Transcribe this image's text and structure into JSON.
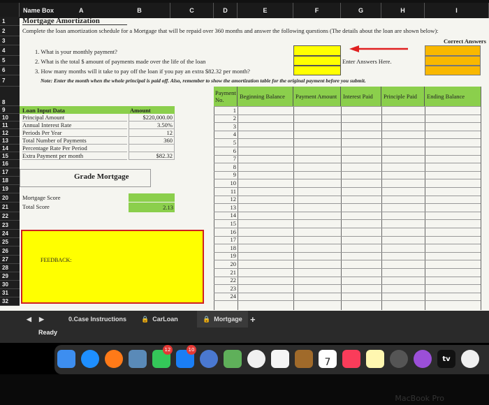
{
  "name_box": {
    "label": "Name Box",
    "current_col": "A"
  },
  "columns": [
    "B",
    "C",
    "D",
    "E",
    "F",
    "G",
    "H",
    "I"
  ],
  "rows": [
    "1",
    "2",
    "3",
    "4",
    "5",
    "6",
    "7",
    "8",
    "9",
    "10",
    "11",
    "12",
    "13",
    "14",
    "15",
    "16",
    "17",
    "18",
    "19",
    "20",
    "21",
    "22",
    "23",
    "24",
    "25",
    "26",
    "27",
    "28",
    "29",
    "30",
    "31",
    "32"
  ],
  "title": "Mortgage Amortization",
  "instructions": "Complete the loan amortization schedule for a Mortgage that will be repaid over 360 months and answer the following questions (The details about the loan are shown below):",
  "correct_answers_label": "Correct Answers",
  "questions": [
    "1. What is your monthly payment?",
    "2. What is the total $ amount of payments made over the life of the loan",
    "3. How many months will it take to pay off the loan if you pay an extra $82.32 per month?"
  ],
  "note": "Note: Enter the month when the whole principal is paid off. Also, remember to show the amortization table for the original payment before you submit.",
  "enter_answers_label": "Enter Answers Here.",
  "loan_input": {
    "header_label": "Loan Input Data",
    "header_amount": "Amount",
    "rows": [
      {
        "label": "Principal Amount",
        "value": "$220,000.00"
      },
      {
        "label": "Annual Interest Rate",
        "value": "3.50%"
      },
      {
        "label": "Periods Per Year",
        "value": "12"
      },
      {
        "label": "Total Number of Payments",
        "value": "360"
      },
      {
        "label": "Percentage Rate Per Period",
        "value": ""
      },
      {
        "label": "Extra Payment per month",
        "value": "$82.32"
      }
    ]
  },
  "grade_title": "Grade Mortgage",
  "score": {
    "mortgage_score_label": "Mortgage Score",
    "total_score_label": "Total Score",
    "total_score_value": "2.13"
  },
  "feedback_label": "FEEDBACK:",
  "table_headers": [
    "Payment No.",
    "Beginning Balance",
    "Payment Amount",
    "Interest Paid",
    "Principle Paid",
    "Ending Balance"
  ],
  "payment_numbers": [
    "1",
    "2",
    "3",
    "4",
    "5",
    "6",
    "7",
    "8",
    "9",
    "10",
    "11",
    "12",
    "13",
    "14",
    "15",
    "16",
    "17",
    "18",
    "19",
    "20",
    "21",
    "22",
    "23",
    "24"
  ],
  "sheet_tabs": [
    "0.Case Instructions",
    "CarLoan",
    "Mortgage"
  ],
  "add_sheet": "+",
  "status": "Ready",
  "dock_badges": {
    "calendar_date": "7",
    "tv_label": "tv",
    "messages_badge": "12",
    "appstore_badge": "10"
  },
  "bezel_text": "MacBook Pro",
  "colors": {
    "green": "#8bcf4c",
    "yellow": "#ffff00",
    "orange": "#f9b800",
    "arrow": "#e02020"
  }
}
